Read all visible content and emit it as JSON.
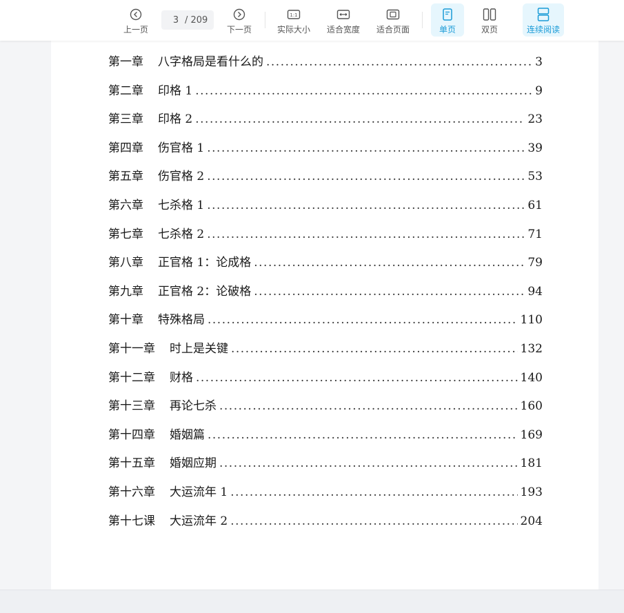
{
  "toolbar": {
    "prev_label": "上一页",
    "next_label": "下一页",
    "current_page": "3",
    "total_pages": "/ 209",
    "actual_size_label": "实际大小",
    "fit_width_label": "适合宽度",
    "fit_page_label": "适合页面",
    "single_page_label": "单页",
    "double_page_label": "双页",
    "continuous_label": "连续阅读",
    "accent_color": "#1a9bd7"
  },
  "document": {
    "toc": [
      {
        "chapter": "第一章",
        "title": "八字格局是看什么的",
        "page": "3"
      },
      {
        "chapter": "第二章",
        "title": "印格 1",
        "page": "9"
      },
      {
        "chapter": "第三章",
        "title": "印格 2",
        "page": "23"
      },
      {
        "chapter": "第四章",
        "title": "伤官格 1",
        "page": "39"
      },
      {
        "chapter": "第五章",
        "title": "伤官格 2",
        "page": "53"
      },
      {
        "chapter": "第六章",
        "title": "七杀格 1",
        "page": "61"
      },
      {
        "chapter": "第七章",
        "title": "七杀格 2",
        "page": "71"
      },
      {
        "chapter": "第八章",
        "title": "正官格 1：论成格",
        "page": "79"
      },
      {
        "chapter": "第九章",
        "title": "正官格 2：论破格",
        "page": "94"
      },
      {
        "chapter": "第十章",
        "title": "特殊格局",
        "page": "110"
      },
      {
        "chapter": "第十一章",
        "title": "时上是关键",
        "page": "132"
      },
      {
        "chapter": "第十二章",
        "title": "财格",
        "page": "140"
      },
      {
        "chapter": "第十三章",
        "title": "再论七杀",
        "page": "160"
      },
      {
        "chapter": "第十四章",
        "title": "婚姻篇",
        "page": "169"
      },
      {
        "chapter": "第十五章",
        "title": "婚姻应期",
        "page": "181"
      },
      {
        "chapter": "第十六章",
        "title": "大运流年 1",
        "page": "193"
      },
      {
        "chapter": "第十七课",
        "title": "大运流年 2",
        "page": "204"
      }
    ]
  }
}
